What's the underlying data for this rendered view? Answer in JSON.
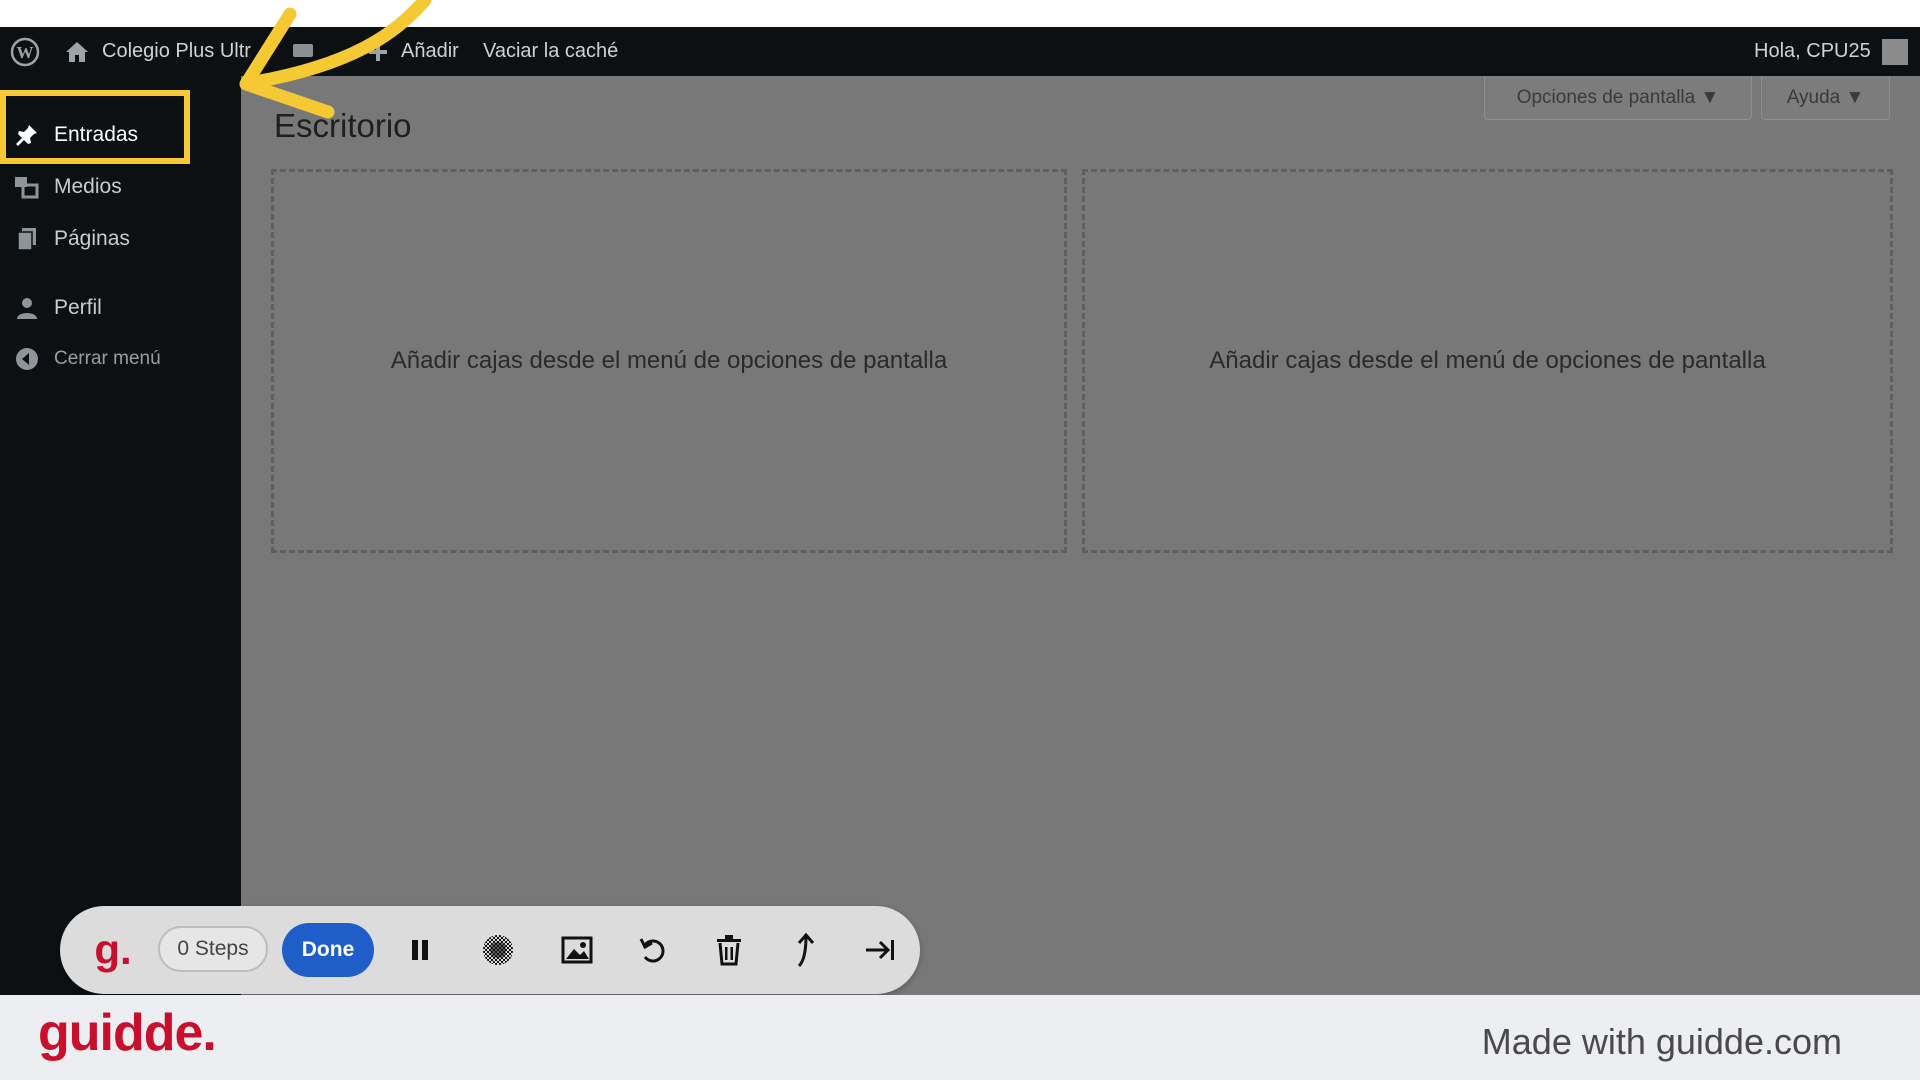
{
  "admin_bar": {
    "site_name": "Colegio Plus Ultr",
    "add_label": "Añadir",
    "clear_cache_label": "Vaciar la caché",
    "greeting": "Hola, CPU25"
  },
  "sidebar": {
    "items": [
      {
        "label": "Entradas",
        "icon": "pin-icon"
      },
      {
        "label": "Medios",
        "icon": "media-icon"
      },
      {
        "label": "Páginas",
        "icon": "pages-icon"
      },
      {
        "label": "Perfil",
        "icon": "user-icon"
      },
      {
        "label": "Cerrar menú",
        "icon": "collapse-icon"
      }
    ]
  },
  "main": {
    "screen_options_label": "Opciones de pantalla ▼",
    "help_label": "Ayuda ▼",
    "title": "Escritorio",
    "dropzones": [
      "Añadir cajas desde el menú de opciones de pantalla",
      "Añadir cajas desde el menú de opciones de pantalla"
    ]
  },
  "recorder": {
    "logo": "g.",
    "steps_label": "0 Steps",
    "done_label": "Done",
    "icons": [
      "pause-icon",
      "blur-icon",
      "image-icon",
      "undo-icon",
      "trash-icon",
      "upload-icon",
      "skip-icon"
    ]
  },
  "footer": {
    "brand": "guidde.",
    "made_with": "Made with guidde.com"
  },
  "colors": {
    "highlight": "#f5c933",
    "admin_bar_bg": "#0d1013",
    "overlay_bg": "#787878",
    "done_button": "#1f5ec8",
    "brand_red": "#c8102e"
  }
}
